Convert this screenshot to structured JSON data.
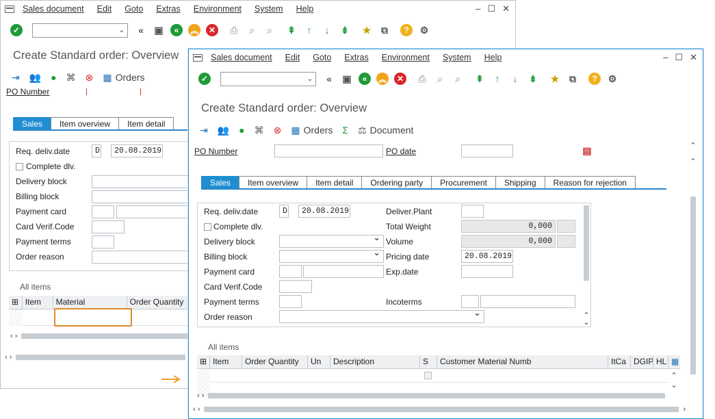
{
  "menu": {
    "items": [
      "Sales document",
      "Edit",
      "Goto",
      "Extras",
      "Environment",
      "System",
      "Help"
    ]
  },
  "back": {
    "title": "Create Standard order: Overview",
    "app_toolbar": {
      "orders": "Orders"
    },
    "header": {
      "po_number": "PO Number"
    },
    "tabs": [
      "Sales",
      "Item overview",
      "Item detail"
    ],
    "fields": {
      "req_deliv_date": "Req. deliv.date",
      "date_type": "D",
      "date_value": "20.08.2019",
      "complete_dlv": "Complete dlv.",
      "delivery_block": "Delivery block",
      "billing_block": "Billing block",
      "payment_card": "Payment card",
      "card_verif": "Card Verif.Code",
      "payment_terms": "Payment terms",
      "order_reason": "Order reason"
    },
    "items": {
      "title": "All items",
      "columns": [
        "Item",
        "Material",
        "Order Quantity"
      ]
    }
  },
  "front": {
    "title": "Create Standard order: Overview",
    "app_toolbar": {
      "orders": "Orders",
      "sum": "Σ",
      "document": "Document"
    },
    "header": {
      "po_number": "PO Number",
      "po_date": "PO date"
    },
    "tabs": [
      "Sales",
      "Item overview",
      "Item detail",
      "Ordering party",
      "Procurement",
      "Shipping",
      "Reason for rejection"
    ],
    "fields": {
      "req_deliv_date": "Req. deliv.date",
      "date_type": "D",
      "date_value": "20.08.2019",
      "complete_dlv": "Complete dlv.",
      "delivery_block": "Delivery block",
      "billing_block": "Billing block",
      "payment_card": "Payment card",
      "card_verif": "Card Verif.Code",
      "payment_terms": "Payment terms",
      "order_reason": "Order reason",
      "deliver_plant": "Deliver.Plant",
      "total_weight": "Total Weight",
      "total_weight_value": "0,000",
      "volume": "Volume",
      "volume_value": "0,000",
      "pricing_date": "Pricing date",
      "pricing_date_value": "20.08.2019",
      "exp_date": "Exp.date",
      "incoterms": "Incoterms"
    },
    "items": {
      "title": "All items",
      "columns": [
        "Item",
        "Order Quantity",
        "Un",
        "Description",
        "S",
        "Customer Material Numb",
        "ItCa",
        "DGIP",
        "HL"
      ]
    }
  },
  "colors": {
    "accent": "#1f8ed2",
    "ok": "#1f9a3a",
    "cancel": "#d9262b",
    "exit": "#f0a418",
    "arrow": "#f0a030"
  },
  "icons": [
    "check-icon",
    "back-icon",
    "save-icon",
    "exit-icon",
    "cancel-icon",
    "print-icon",
    "find-icon",
    "first-page-icon",
    "prev-page-icon",
    "next-page-icon",
    "last-page-icon",
    "help-icon",
    "settings-icon"
  ]
}
